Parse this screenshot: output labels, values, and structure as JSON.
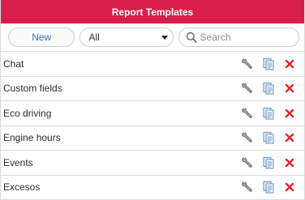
{
  "header": {
    "title": "Report Templates"
  },
  "toolbar": {
    "new_label": "New",
    "filter_value": "All",
    "search_placeholder": "Search"
  },
  "rows": [
    {
      "name": "Chat"
    },
    {
      "name": "Custom fields"
    },
    {
      "name": "Eco driving"
    },
    {
      "name": "Engine hours"
    },
    {
      "name": "Events"
    },
    {
      "name": "Excesos"
    }
  ],
  "colors": {
    "header_bg": "#d81f4b",
    "accent_blue": "#2f74c9",
    "delete_red": "#e3242b"
  },
  "icons": {
    "edit": "wrench-icon",
    "copy": "copy-icon",
    "delete": "delete-icon"
  }
}
